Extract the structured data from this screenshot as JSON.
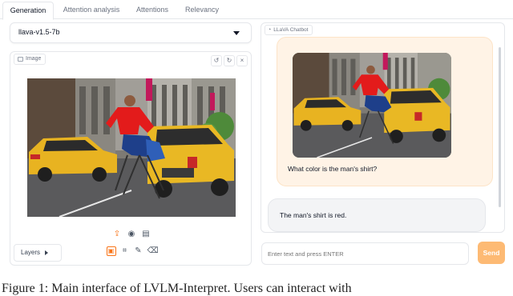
{
  "tabs": [
    {
      "label": "Generation",
      "active": true
    },
    {
      "label": "Attention analysis",
      "active": false
    },
    {
      "label": "Attentions",
      "active": false
    },
    {
      "label": "Relevancy",
      "active": false
    }
  ],
  "model_select": {
    "value": "llava-v1.5-7b"
  },
  "image_panel": {
    "label": "Image",
    "tools": [
      "undo",
      "redo",
      "clear"
    ],
    "upload_icons": [
      "upload-icon",
      "webcam-icon",
      "clipboard-icon"
    ],
    "edit_icons": [
      "image-icon",
      "crop-icon",
      "brush-icon",
      "eraser-icon"
    ],
    "layers_label": "Layers"
  },
  "chat": {
    "label": "LLaVA Chatbot",
    "user_message": "What color is the man's shirt?",
    "bot_message": "The man's shirt is red."
  },
  "input": {
    "placeholder": "Enter text and press ENTER"
  },
  "send_label": "Send",
  "caption": "Figure 1: Main interface of LVLM-Interpret. Users can interact with"
}
